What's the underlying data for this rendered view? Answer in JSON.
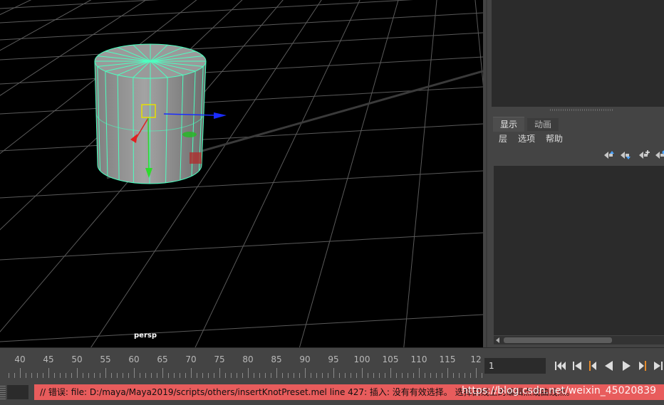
{
  "viewport": {
    "camera_label": "persp"
  },
  "right_panel": {
    "tabs": [
      "显示",
      "动画"
    ],
    "menu": [
      "层",
      "选项",
      "帮助"
    ],
    "layer_tools": [
      "move-layer-up-icon",
      "move-layer-down-icon",
      "new-layer-icon",
      "new-layer-from-selection-icon"
    ]
  },
  "time_slider": {
    "labels": [
      "40",
      "45",
      "50",
      "55",
      "60",
      "65",
      "70",
      "75",
      "80",
      "85",
      "90",
      "95",
      "100",
      "105",
      "110",
      "115",
      "12"
    ]
  },
  "playback": {
    "current_frame": "1",
    "buttons": [
      "go-to-start-icon",
      "step-back-frame-icon",
      "step-back-key-icon",
      "play-backwards-icon",
      "play-forwards-icon",
      "step-forward-key-icon",
      "step-forward-frame-icon"
    ]
  },
  "command_line": {
    "error_text": "// 错误: file: D:/maya/Maya2019/scripts/others/insertKnotPreset.mel line 427: 插入: 没有有效选择。 选择曲线上的编辑点或曲线点。"
  },
  "watermark": "https://blog.csdn.net/weixin_45020839",
  "colors": {
    "wire_selected": "#4dffc0",
    "command_error_bg": "#e85c5c",
    "panel_bg": "#444444",
    "dark_bg": "#2b2b2b"
  }
}
